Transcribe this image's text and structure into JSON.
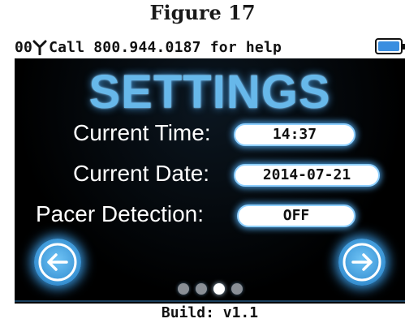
{
  "figure": {
    "caption": "Figure 17"
  },
  "statusbar": {
    "signal_prefix": "00",
    "message": "Call 800.944.0187 for help",
    "icons": {
      "signal": "antenna-signal-icon",
      "battery": "battery-icon"
    },
    "battery_level": 1.0
  },
  "screen": {
    "title": "SETTINGS",
    "rows": [
      {
        "label": "Current Time:",
        "value": "14:37"
      },
      {
        "label": "Current Date:",
        "value": "2014-07-21"
      },
      {
        "label": "Pacer Detection:",
        "value": "OFF"
      }
    ],
    "nav": {
      "prev_icon": "arrow-left-icon",
      "next_icon": "arrow-right-icon"
    },
    "pagination": {
      "total": 4,
      "current": 3
    }
  },
  "footer": {
    "build": "Build: v1.1"
  },
  "colors": {
    "accent": "#67b8ea",
    "glow": "#3b95d6",
    "background": "#000000",
    "battery_fill": "#3a8ee0"
  }
}
